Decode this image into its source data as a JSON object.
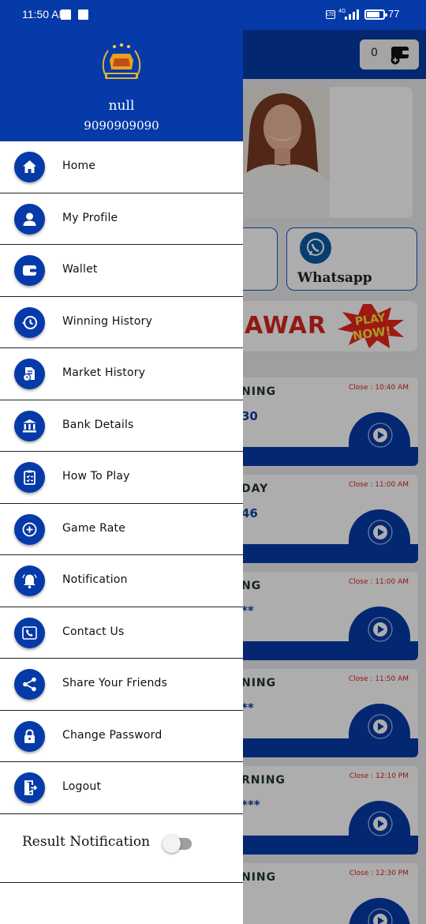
{
  "status_bar": {
    "time": "11:50 AM",
    "network": "4G",
    "volte": "LTE",
    "battery": "77"
  },
  "background": {
    "wallet_count": "0",
    "whatsapp_label": "Whatsapp",
    "banner_text": "AWAR",
    "banner_badge": "PLAY NOW!",
    "markets": [
      {
        "name": "NING",
        "close": "Close : 10:40 AM",
        "result": "30"
      },
      {
        "name": "DAY",
        "close": "Close : 11:00 AM",
        "result": "46"
      },
      {
        "name": "NG",
        "close": "Close : 11:00 AM",
        "result": "**"
      },
      {
        "name": "NING",
        "close": "Close : 11:50 AM",
        "result": "**"
      },
      {
        "name": "RNING",
        "close": "Close : 12:10 PM",
        "result": "***"
      },
      {
        "name": "NING",
        "close": "Close : 12:30 PM",
        "result": ""
      }
    ]
  },
  "drawer": {
    "user_name": "null",
    "user_phone": "9090909090",
    "menu": [
      {
        "label": "Home",
        "icon": "home-icon"
      },
      {
        "label": "My Profile",
        "icon": "person-icon"
      },
      {
        "label": "Wallet",
        "icon": "wallet-icon"
      },
      {
        "label": "Winning History",
        "icon": "history-icon"
      },
      {
        "label": "Market History",
        "icon": "document-clock-icon"
      },
      {
        "label": "Bank Details",
        "icon": "bank-icon"
      },
      {
        "label": "How To Play",
        "icon": "clipboard-icon"
      },
      {
        "label": "Game Rate",
        "icon": "plus-circle-icon"
      },
      {
        "label": "Notification",
        "icon": "bell-icon"
      },
      {
        "label": "Contact Us",
        "icon": "phone-icon"
      },
      {
        "label": "Share Your Friends",
        "icon": "share-icon"
      },
      {
        "label": "Change Password",
        "icon": "lock-icon"
      },
      {
        "label": "Logout",
        "icon": "logout-icon"
      }
    ],
    "result_notification_label": "Result Notification",
    "result_notification_on": false
  },
  "colors": {
    "primary": "#063aa8",
    "close_text": "#d32222"
  }
}
